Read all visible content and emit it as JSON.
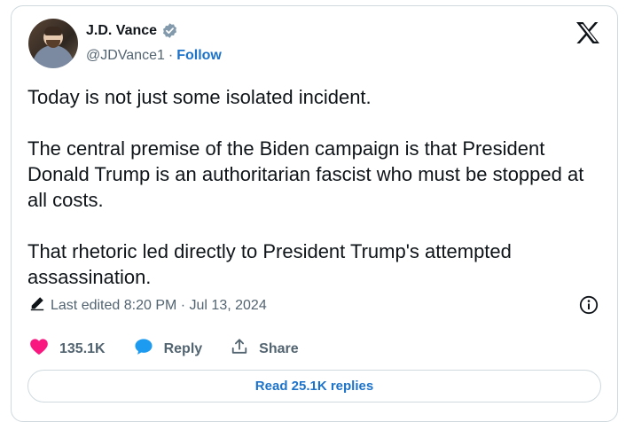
{
  "author": {
    "display_name": "J.D. Vance",
    "handle": "@JDVance1",
    "separator": "·",
    "follow_label": "Follow"
  },
  "tweet": {
    "paragraphs": [
      "Today is not just some isolated incident.",
      "The central premise of the Biden campaign is that President Donald Trump is an authoritarian fascist who must be stopped at all costs.",
      "That rhetoric led directly to President Trump's attempted assassination."
    ],
    "edited_text": "Last edited 8:20 PM · Jul 13, 2024"
  },
  "actions": {
    "like_count": "135.1K",
    "reply_label": "Reply",
    "share_label": "Share",
    "read_replies_label": "Read 25.1K replies"
  },
  "icons": {
    "verified": "verified-badge-icon",
    "logo": "x-logo-icon",
    "edit": "pencil-icon",
    "info": "info-icon",
    "like": "heart-icon",
    "reply": "speech-bubble-icon",
    "share": "share-upload-icon"
  },
  "colors": {
    "accent": "#1d73c9",
    "like": "#f91880",
    "reply": "#1d9bf0",
    "muted": "#536471",
    "border": "#cfd9de"
  }
}
